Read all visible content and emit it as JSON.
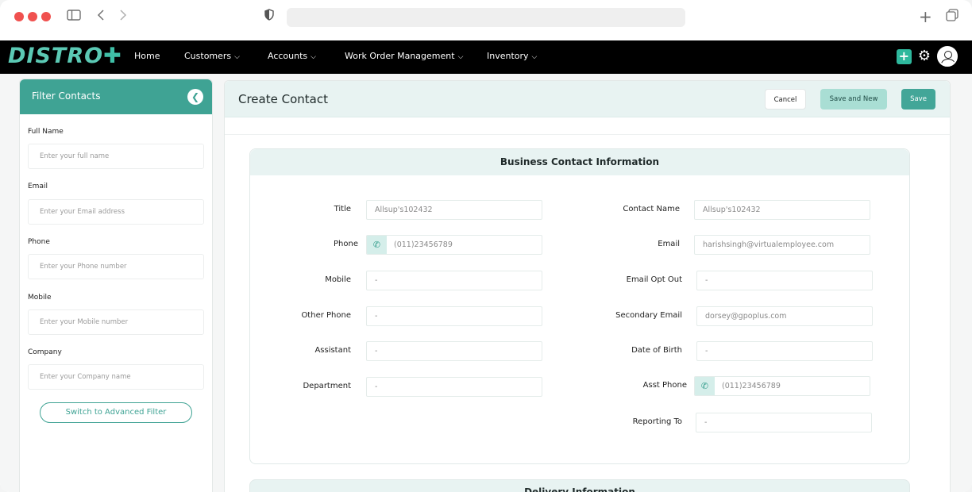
{
  "browser": {
    "url": ""
  },
  "nav": {
    "logo": "DISTRO",
    "logo_plus": "✚",
    "items": [
      {
        "label": "Home",
        "has_dropdown": false
      },
      {
        "label": "Customers",
        "has_dropdown": true
      },
      {
        "label": "Accounts",
        "has_dropdown": true
      },
      {
        "label": "Work Order Management",
        "has_dropdown": true
      },
      {
        "label": "Inventory",
        "has_dropdown": true
      }
    ]
  },
  "sidebar": {
    "title": "Filter Contacts",
    "fields": [
      {
        "label": "Full Name",
        "placeholder": "Enter your full name"
      },
      {
        "label": "Email",
        "placeholder": "Enter your Email address"
      },
      {
        "label": "Phone",
        "placeholder": "Enter your Phone number"
      },
      {
        "label": "Mobile",
        "placeholder": "Enter your Mobile number"
      },
      {
        "label": "Company",
        "placeholder": "Enter your Company name"
      }
    ],
    "advanced_button": "Switch to Advanced Filter"
  },
  "main": {
    "title": "Create Contact",
    "buttons": {
      "cancel": "Cancel",
      "save_and_new": "Save and New",
      "save": "Save"
    },
    "section_title": "Business Contact Information",
    "left_fields": [
      {
        "label": "Title",
        "value": "Allsup's102432"
      },
      {
        "label": "Phone",
        "value": "(011)23456789",
        "icon": "phone-icon"
      },
      {
        "label": "Mobile",
        "value": "-"
      },
      {
        "label": "Other Phone",
        "value": "-"
      },
      {
        "label": "Assistant",
        "value": "-"
      },
      {
        "label": "Department",
        "value": "-"
      }
    ],
    "right_fields": [
      {
        "label": "Contact Name",
        "value": "Allsup's102432"
      },
      {
        "label": "Email",
        "value": "harishsingh@virtualemployee.com"
      },
      {
        "label": "Email Opt Out",
        "value": "-"
      },
      {
        "label": "Secondary Email",
        "value": "dorsey@gpoplus.com"
      },
      {
        "label": "Date of Birth",
        "value": "-"
      },
      {
        "label": "Asst Phone",
        "value": "(011)23456789",
        "icon": "phone-icon"
      },
      {
        "label": "Reporting To",
        "value": "-"
      }
    ],
    "next_section_title": "Delivery Information"
  },
  "colors": {
    "accent": "#3fa394",
    "nav_bg": "#000000",
    "section_head_bg": "#e8f3f2"
  }
}
